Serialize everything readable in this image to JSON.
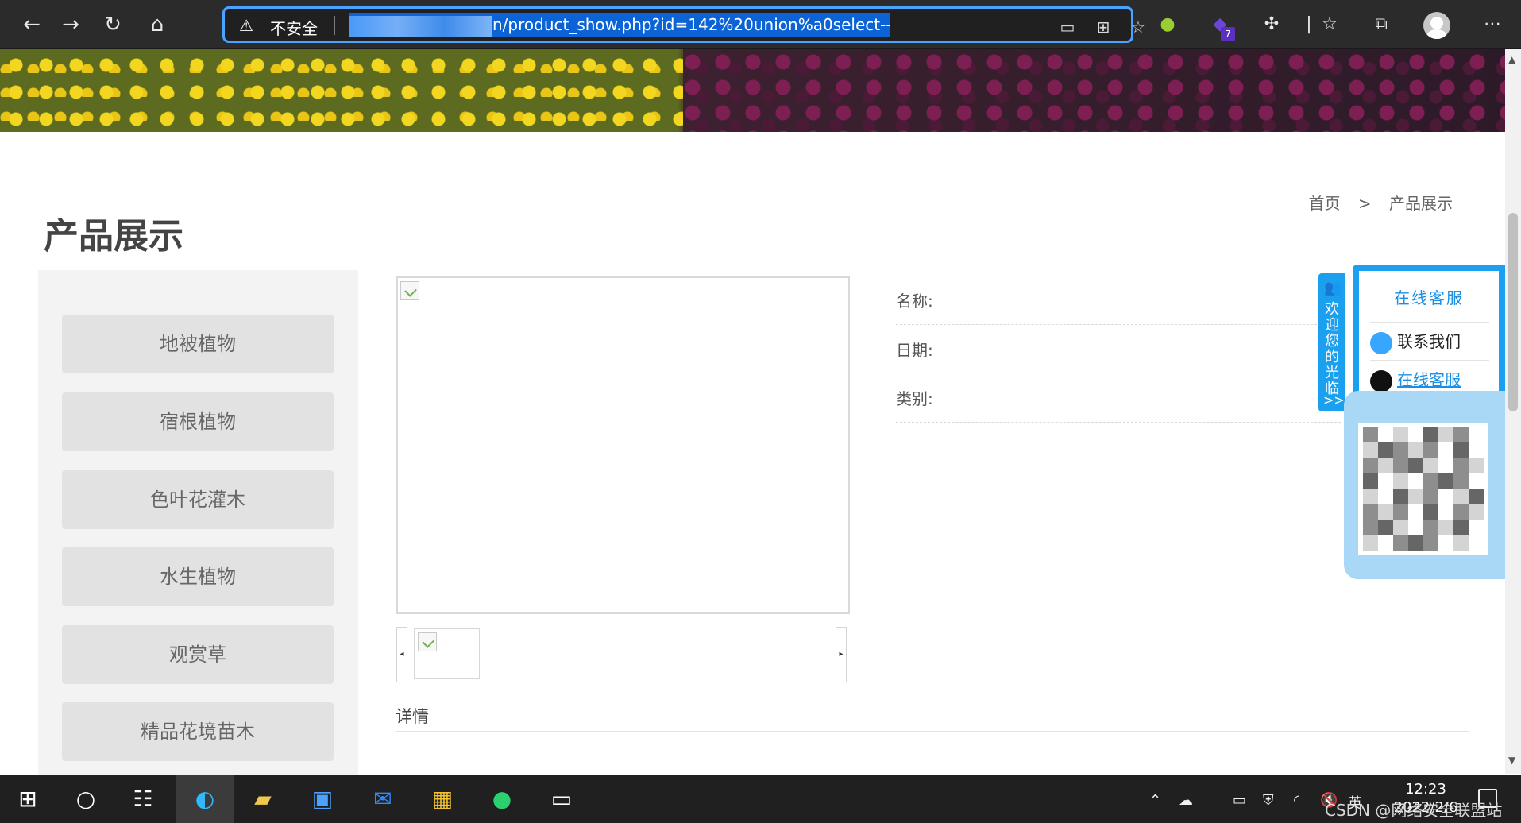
{
  "browser": {
    "security_label": "不安全",
    "url_visible": "n/product_show.php?id=142%20union%a0select--+",
    "extension_badge": "7"
  },
  "icons": {
    "back": "arrow-left-icon",
    "forward": "arrow-right-icon",
    "refresh": "refresh-icon",
    "home": "home-icon",
    "warning": "warning-icon",
    "device": "device-icon",
    "apps": "apps-icon",
    "favorite": "add-favorite-icon",
    "extension_green": "green-extension-icon",
    "extension_purple": "purple-extension-icon",
    "puzzle": "extensions-icon",
    "favorites": "favorites-icon",
    "collections": "collections-icon",
    "more": "more-icon"
  },
  "page": {
    "title": "产品展示",
    "breadcrumb": {
      "home": "首页",
      "separator": ">",
      "current": "产品展示"
    }
  },
  "sidebar": {
    "items": [
      {
        "label": "地被植物"
      },
      {
        "label": "宿根植物"
      },
      {
        "label": "色叶花灌木"
      },
      {
        "label": "水生植物"
      },
      {
        "label": "观赏草"
      },
      {
        "label": "精品花境苗木"
      }
    ]
  },
  "product": {
    "fields": [
      {
        "label": "名称:"
      },
      {
        "label": "日期:"
      },
      {
        "label": "类别:"
      }
    ],
    "details_label": "详情"
  },
  "widget": {
    "welcome_text": "欢迎您的光临",
    "header": "在线客服",
    "contact_label": "联系我们",
    "online_service_label": "在线客服",
    "collapse_symbol": ">>"
  },
  "taskbar": {
    "time": "12:23",
    "date": "2022/2/6",
    "ime": "英",
    "watermark": "CSDN @网络安全联盟站"
  },
  "colors": {
    "browser_bg": "#2b2b2b",
    "address_border": "#4aa3ff",
    "url_highlight": "#0b63d6",
    "widget_blue": "#1aa0ee",
    "taskbar_bg": "#202020"
  }
}
